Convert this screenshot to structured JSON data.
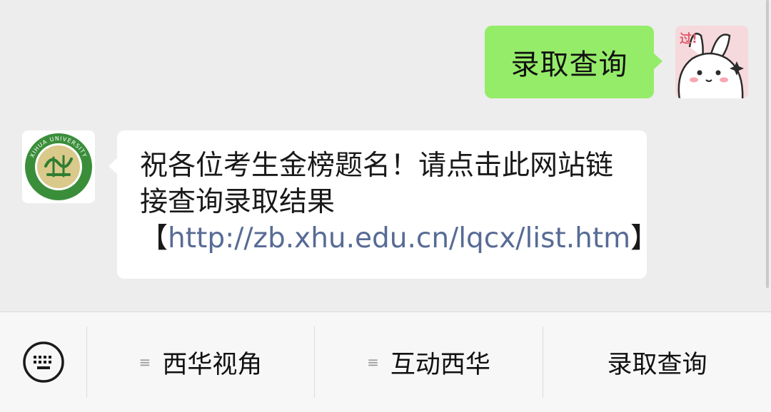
{
  "chat": {
    "outgoing_message": {
      "text": "录取查询"
    },
    "incoming_message": {
      "text": "祝各位考生金榜题名！请点击此网站链接查询录取结果【",
      "link": "http://zb.xhu.edu.cn/lqcx/list.htm",
      "suffix": "】"
    },
    "user_avatar": {
      "badge": "过!"
    },
    "org_avatar": {
      "logo_text": "XIHUA UNIVERSITY"
    }
  },
  "menu_bar": {
    "keyboard_icon": "keyboard-icon",
    "items": [
      {
        "label": "西华视角",
        "icon": "submenu-icon"
      },
      {
        "label": "互动西华",
        "icon": "submenu-icon"
      },
      {
        "label": "录取查询"
      }
    ]
  },
  "colors": {
    "chat_background": "#ededed",
    "outgoing_bubble": "#95ec69",
    "incoming_bubble": "#ffffff",
    "link": "#576b95",
    "menu_background": "#f7f7f7"
  }
}
